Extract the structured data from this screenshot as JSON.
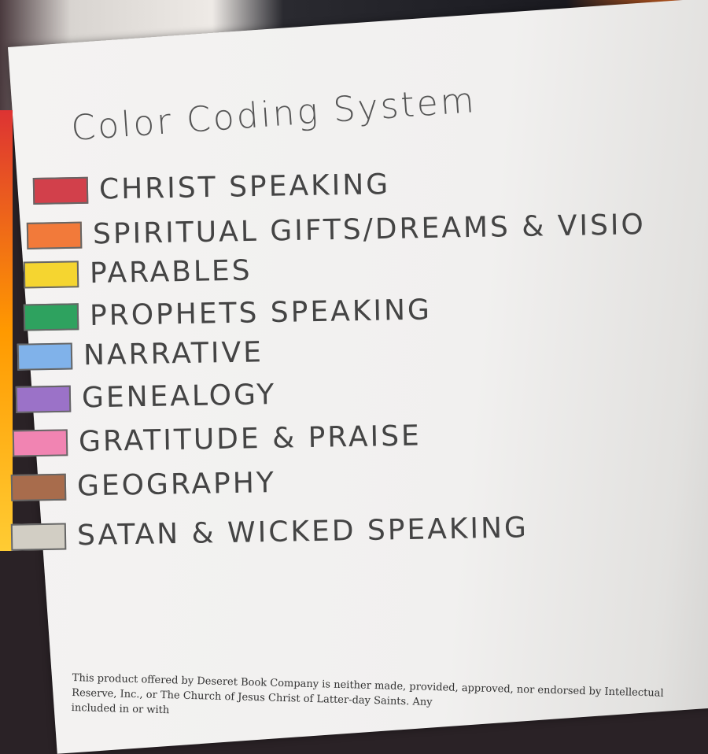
{
  "title": "Color Coding System",
  "items": [
    {
      "label": "CHRIST SPEAKING",
      "color": "#d2404b"
    },
    {
      "label": "SPIRITUAL GIFTS/DREAMS & VISIO",
      "color": "#f27a3a"
    },
    {
      "label": "PARABLES",
      "color": "#f5d530"
    },
    {
      "label": "PROPHETS SPEAKING",
      "color": "#2ea25f"
    },
    {
      "label": "NARRATIVE",
      "color": "#80b2ea"
    },
    {
      "label": "GENEALOGY",
      "color": "#9b72c8"
    },
    {
      "label": "GRATITUDE & PRAISE",
      "color": "#f184b2"
    },
    {
      "label": "GEOGRAPHY",
      "color": "#a86c4c"
    },
    {
      "label": "SATAN & WICKED SPEAKING",
      "color": "#d2cec4"
    }
  ],
  "disclaimer": {
    "line1": "This product offered by Deseret Book Company is neither made, provided, approved, nor endorsed by Intellectual",
    "line2": "Reserve, Inc., or The Church of Jesus Christ of Latter-day Saints. Any",
    "line3": "included in or with"
  }
}
